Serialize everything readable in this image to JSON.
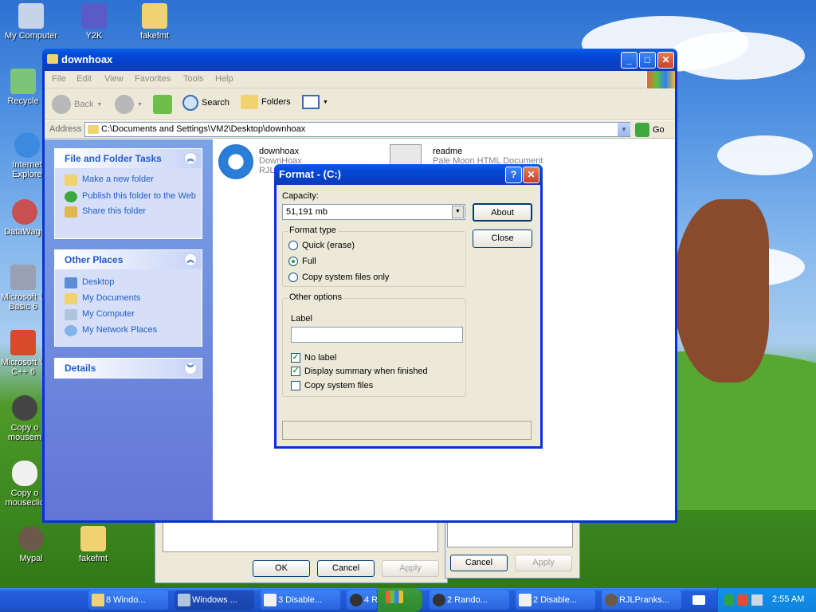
{
  "desktop": {
    "icons": [
      {
        "label": "My Computer"
      },
      {
        "label": "Y2K"
      },
      {
        "label": "fakefmt"
      },
      {
        "label": "Recycle"
      },
      {
        "label": "Internet\nExplore"
      },
      {
        "label": "DataWago"
      },
      {
        "label": "Microsoft V\nBasic 6"
      },
      {
        "label": "Microsoft V\nC++ 6"
      },
      {
        "label": "Copy o\nmousem"
      },
      {
        "label": "Copy o\nmouseclic"
      },
      {
        "label": "Mypal"
      },
      {
        "label": "fakefmt"
      }
    ]
  },
  "bg_windows": {
    "ok": "OK",
    "cancel": "Cancel",
    "apply": "Apply",
    "cancel2": "Cancel",
    "apply2": "Apply"
  },
  "explorer": {
    "title": "downhoax",
    "menu": [
      "File",
      "Edit",
      "View",
      "Favorites",
      "Tools",
      "Help"
    ],
    "toolbar": {
      "back": "Back",
      "search": "Search",
      "folders": "Folders"
    },
    "address": {
      "label": "Address",
      "path": "C:\\Documents and Settings\\VM2\\Desktop\\downhoax",
      "go": "Go"
    },
    "tasks": {
      "title": "File and Folder Tasks",
      "links": [
        "Make a new folder",
        "Publish this folder to the Web",
        "Share this folder"
      ]
    },
    "places": {
      "title": "Other Places",
      "links": [
        "Desktop",
        "My Documents",
        "My Computer",
        "My Network Places"
      ]
    },
    "details": {
      "title": "Details"
    },
    "files": [
      {
        "name": "downhoax",
        "line2": "DownHoax",
        "line3": "RJL"
      },
      {
        "name": "readme",
        "line2": "Pale Moon HTML Document"
      }
    ]
  },
  "format": {
    "title": "Format -  (C:)",
    "capacity_label": "Capacity:",
    "capacity_value": "51,191 mb",
    "format_type": "Format type",
    "quick": "Quick (erase)",
    "full": "Full",
    "copy_sys_only": "Copy system files only",
    "selected_type": "Full",
    "other_options": "Other options",
    "label": "Label",
    "label_value": "",
    "no_label": "No label",
    "display_summary": "Display summary when finished",
    "copy_sys": "Copy system files",
    "no_label_checked": true,
    "display_summary_checked": true,
    "copy_sys_checked": false,
    "about": "About",
    "close": "Close"
  },
  "taskbar": {
    "tasks": [
      "8 Windo...",
      "Windows ...",
      "3 Disable...",
      "4 Ra",
      "2 Rando...",
      "2 Disable...",
      "RJLPranks..."
    ],
    "clock": "2:55 AM"
  },
  "colors": {
    "title_blue": "#0a5fe8",
    "taskbar_blue": "#245edb",
    "panel_blue": "#6375d6"
  }
}
